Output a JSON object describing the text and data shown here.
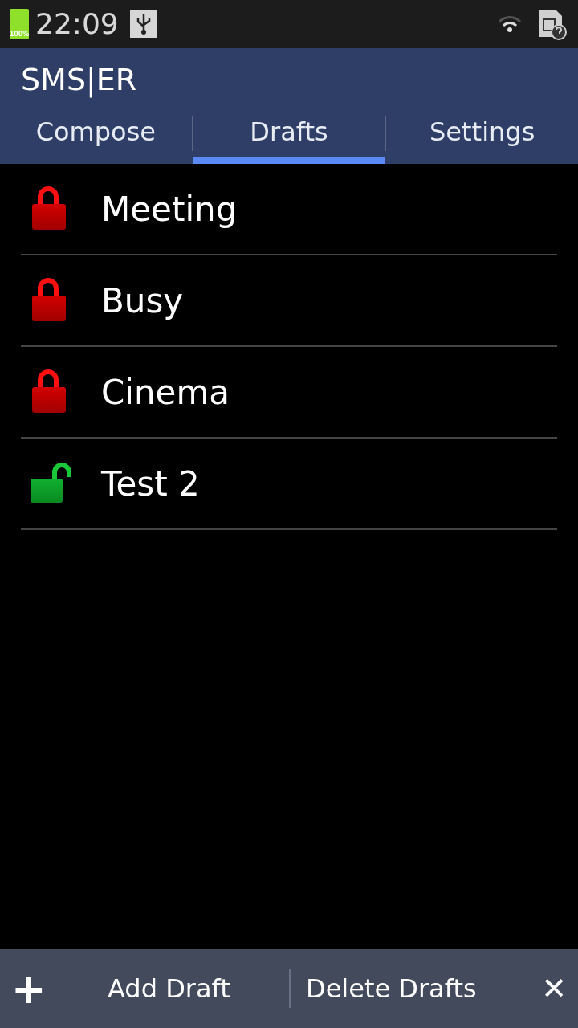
{
  "status_bar": {
    "battery": "100%",
    "time": "22:09"
  },
  "app": {
    "title": "SMS|ER"
  },
  "tabs": [
    {
      "label": "Compose",
      "selected": false
    },
    {
      "label": "Drafts",
      "selected": true
    },
    {
      "label": "Settings",
      "selected": false
    }
  ],
  "drafts": [
    {
      "name": "Meeting",
      "locked": true
    },
    {
      "name": "Busy",
      "locked": true
    },
    {
      "name": "Cinema",
      "locked": true
    },
    {
      "name": "Test 2",
      "locked": false
    }
  ],
  "bottom_bar": {
    "add_icon": "+",
    "add_label": "Add Draft",
    "delete_label": "Delete Drafts",
    "close_icon": "✕"
  }
}
